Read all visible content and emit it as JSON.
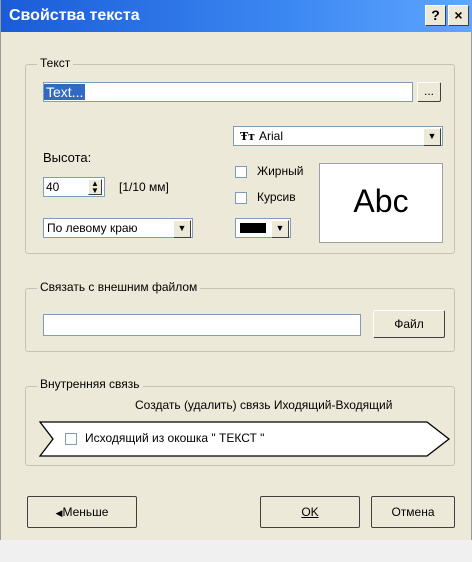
{
  "dialog": {
    "title": "Свойства текста",
    "help_button": "?",
    "close_button": "×"
  },
  "text_group": {
    "label": "Текст",
    "text_value": "Text...",
    "browse_button": "...",
    "font_name": "Arial",
    "font_icon": "Ŧт",
    "height_label": "Высота:",
    "height_value": "40",
    "height_units": "[1/10 мм]",
    "bold_label": "Жирный",
    "italic_label": "Курсив",
    "align_value": "По левому краю",
    "preview_text": "Abc",
    "color_value": "#000000"
  },
  "file_group": {
    "label": "Связать с внешним файлом",
    "file_path": "",
    "file_button": "Файл"
  },
  "link_group": {
    "label": "Внутренняя связь",
    "create_link_label": "Создать (удалить) связь Иходящий-Входящий",
    "outgoing_label": "Исходящий из окошка \" ТЕКСТ \""
  },
  "buttons": {
    "less_label": "Меньше",
    "ok_label": "OK",
    "cancel_label": "Отмена"
  }
}
